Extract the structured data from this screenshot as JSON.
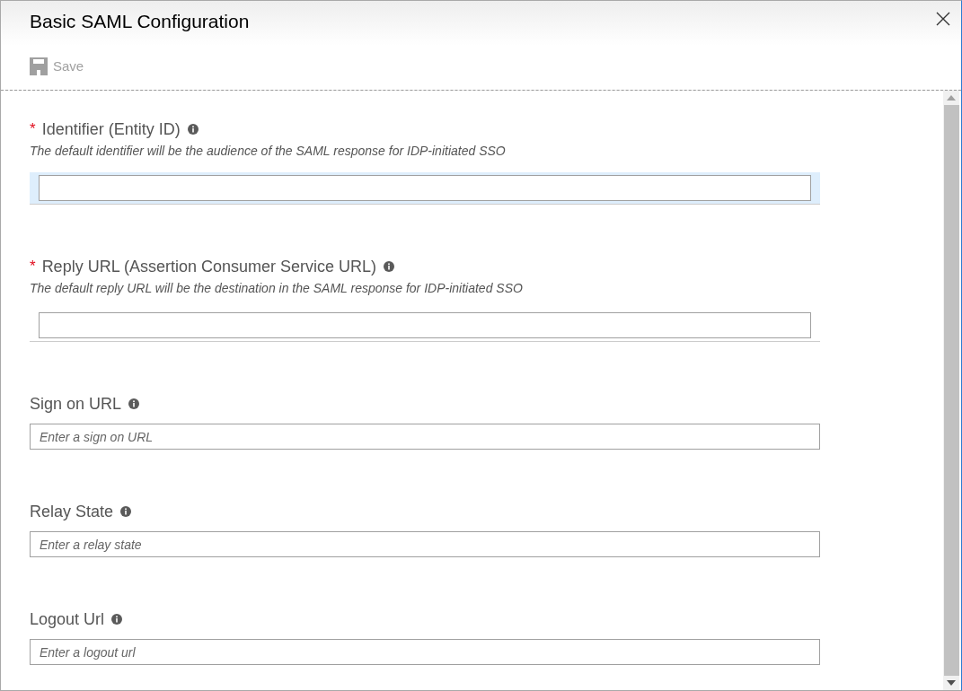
{
  "window": {
    "title": "Basic SAML Configuration"
  },
  "toolbar": {
    "save": {
      "label": "Save",
      "disabled": true
    }
  },
  "fields": [
    {
      "kind": "required",
      "marker": "*",
      "label": "Identifier (Entity ID)",
      "description": "The default identifier will be the audience of the SAML response for IDP-initiated SSO",
      "focused": true
    },
    {
      "kind": "required",
      "marker": "*",
      "label": "Reply URL (Assertion Consumer Service URL)",
      "description": "The default reply URL will be the destination in the SAML response for IDP-initiated SSO",
      "focused": false
    },
    {
      "kind": "optional",
      "label": "Sign on URL",
      "placeholder": "Enter a sign on URL"
    },
    {
      "kind": "optional",
      "label": "Relay State",
      "placeholder": "Enter a relay state"
    },
    {
      "kind": "optional",
      "label": "Logout Url",
      "placeholder": "Enter a logout url"
    }
  ]
}
